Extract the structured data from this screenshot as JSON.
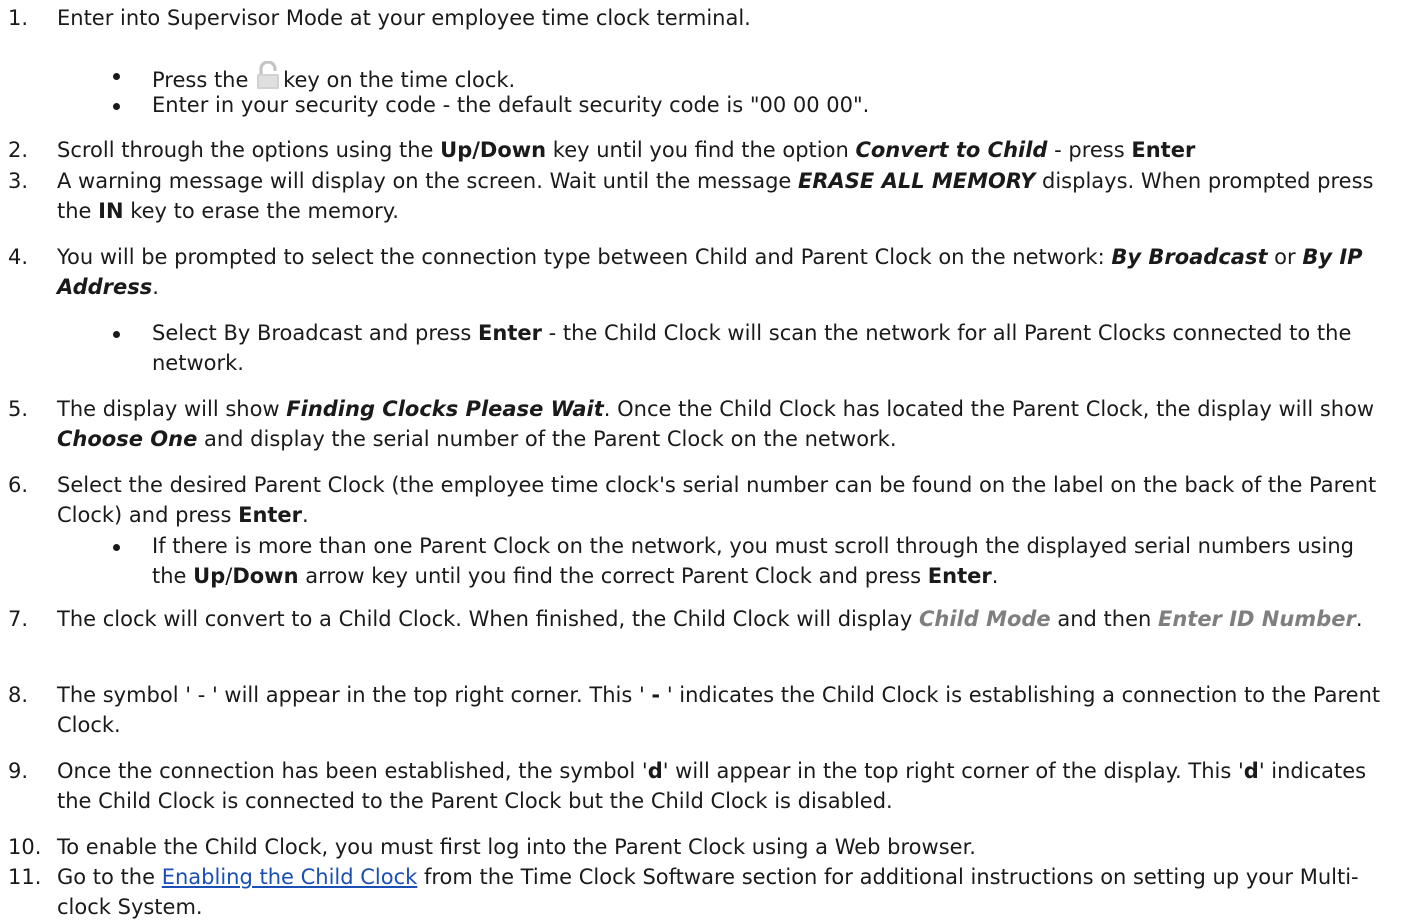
{
  "steps": [
    {
      "num": "1.",
      "text": "Enter into Supervisor Mode at your employee time clock terminal."
    },
    {
      "num": "2.",
      "t1": "Scroll through the options using the ",
      "b1": "Up/Down",
      "t2": " key until you find the option ",
      "bi1": "Convert to Child",
      "t3": " - press ",
      "b2": "Enter"
    },
    {
      "num": "3.",
      "t1": "A warning message will display on the screen. Wait until the message ",
      "bi1": "ERASE ALL MEMORY",
      "t2": " displays. When prompted press the ",
      "b1": "IN",
      "t3": " key to erase the memory."
    },
    {
      "num": "4.",
      "t1": "You will be prompted to select the connection type between Child and Parent Clock on the network: ",
      "bi1": "By Broadcast",
      "t2": " or ",
      "bi2": "By IP Address",
      "t3": "."
    },
    {
      "num": "5.",
      "t1": "The display will show ",
      "bi1": "Finding Clocks Please Wait",
      "t2": ". Once the Child Clock has located the Parent Clock, the display will show ",
      "bi2": "Choose One",
      "t3": " and display the serial number of the Parent Clock on the network."
    },
    {
      "num": "6.",
      "t1": "Select the desired Parent Clock (the employee time clock's serial number can be found on the label on the back of the Parent Clock) and press ",
      "b1": "Enter",
      "t2": "."
    },
    {
      "num": "7.",
      "t1": "The clock will convert to a Child Clock. When finished, the Child Clock will display ",
      "gbi1": "Child Mode",
      "t2": " and then ",
      "gbi2": "Enter ID Number",
      "t3": "."
    },
    {
      "num": "8.",
      "t1": "The symbol ' - ' will appear in the top right corner. This ' ",
      "b1": "-",
      "t2": " ' indicates the Child Clock is establishing a connection to the Parent Clock."
    },
    {
      "num": "9.",
      "t1": "Once the connection has been established, the symbol '",
      "b1": "d",
      "t2": "' will appear in the top right corner of the display. This '",
      "b2": "d",
      "t3": "' indicates the Child Clock is connected to the Parent Clock but the Child Clock is disabled."
    },
    {
      "num": "10.",
      "text": "To enable the Child Clock, you must first log into the Parent Clock using a Web browser."
    },
    {
      "num": "11.",
      "t1": "Go to the ",
      "link": "Enabling the Child Clock",
      "t2": " from the Time Clock Software section for additional instructions on setting up your Multi-clock System."
    }
  ],
  "bullets": {
    "b1a_1": "Press the ",
    "b1a_2": "key on the time clock.",
    "b1b": "Enter in your security code - the default security code is \"00 00 00\".",
    "b4a_1": "Select By Broadcast and press ",
    "b4a_b": "Enter",
    "b4a_2": " - the Child Clock will scan the network for all Parent Clocks connected to the network.",
    "b6a_1": "If there is more than one Parent Clock on the network, you must scroll through the displayed serial numbers using the ",
    "b6a_b1": "Up",
    "b6a_sep": "/",
    "b6a_b2": "Down",
    "b6a_2": " arrow key until you find the correct Parent Clock and press ",
    "b6a_b3": "Enter",
    "b6a_3": "."
  },
  "icons": {
    "lock": "unlocked-padlock-icon"
  }
}
